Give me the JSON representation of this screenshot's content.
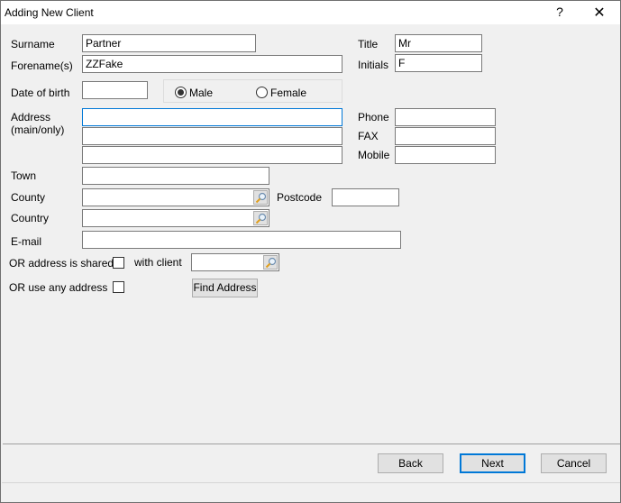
{
  "window": {
    "title": "Adding New Client",
    "help_label": "?",
    "close_label": "✕"
  },
  "form": {
    "surname": {
      "label": "Surname",
      "value": "Partner"
    },
    "forenames": {
      "label": "Forename(s)",
      "value": "ZZFake"
    },
    "title": {
      "label": "Title",
      "value": "Mr"
    },
    "initials": {
      "label": "Initials",
      "value": "F"
    },
    "dob": {
      "label": "Date of birth",
      "value": ""
    },
    "gender": {
      "options": [
        {
          "label": "Male",
          "selected": true
        },
        {
          "label": "Female",
          "selected": false
        }
      ]
    },
    "address": {
      "label_line1": "Address",
      "label_line2": "(main/only)",
      "lines": [
        "",
        "",
        ""
      ]
    },
    "phone": {
      "label": "Phone",
      "value": ""
    },
    "fax": {
      "label": "FAX",
      "value": ""
    },
    "mobile": {
      "label": "Mobile",
      "value": ""
    },
    "town": {
      "label": "Town",
      "value": ""
    },
    "county": {
      "label": "County",
      "value": ""
    },
    "postcode": {
      "label": "Postcode",
      "value": ""
    },
    "country": {
      "label": "Country",
      "value": ""
    },
    "email": {
      "label": "E-mail",
      "value": ""
    },
    "shared": {
      "label": "OR address is shared",
      "checked": false,
      "with_client_label": "with client",
      "with_client_value": ""
    },
    "any_address": {
      "label": "OR use any address",
      "checked": false
    },
    "find_address_label": "Find Address"
  },
  "footer": {
    "back_label": "Back",
    "next_label": "Next",
    "cancel_label": "Cancel"
  },
  "icons": {
    "lookup": "magnifier-icon"
  }
}
